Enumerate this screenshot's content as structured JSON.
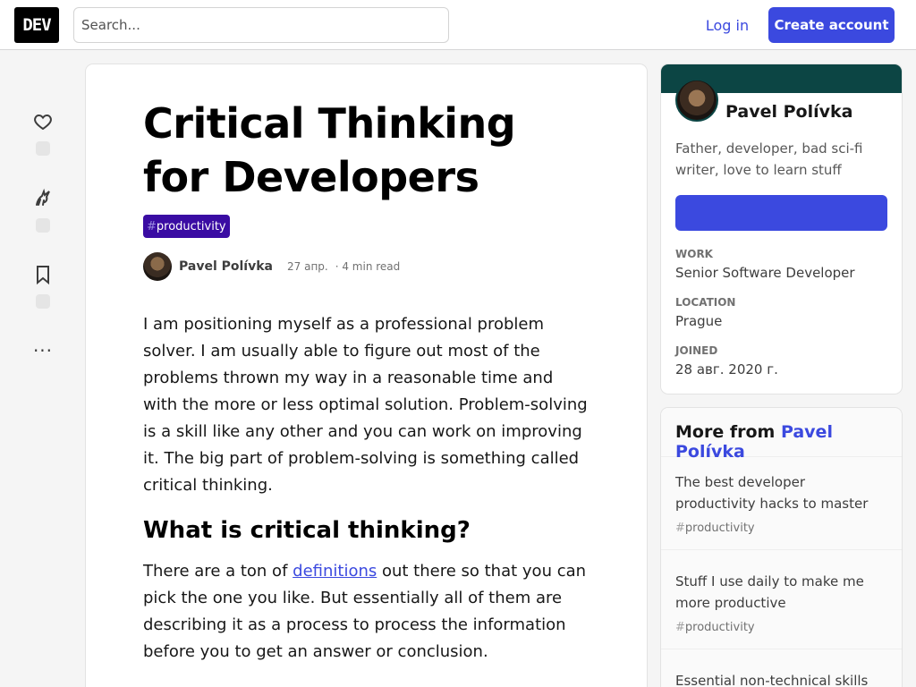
{
  "header": {
    "logo": "DEV",
    "search_placeholder": "Search...",
    "login_label": "Log in",
    "create_account_label": "Create account"
  },
  "actions": {
    "icons": [
      "heart-icon",
      "unicorn-icon",
      "bookmark-icon"
    ],
    "more_label": "···"
  },
  "article": {
    "title": "Critical Thinking for Developers",
    "tag_hash": "#",
    "tag": "productivity",
    "author": "Pavel Polívka",
    "date": "27 апр.",
    "read_time": "· 4 min read",
    "paragraph1": "I am positioning myself as a professional problem solver. I am usually able to figure out most of the problems thrown my way in a reasonable time and with the more or less optimal solution. Problem-solving is a skill like any other and you can work on improving it. The big part of problem-solving is something called critical thinking.",
    "heading2": "What is critical thinking?",
    "paragraph2_before": "There are a ton of ",
    "paragraph2_link": "definitions",
    "paragraph2_after": " out there so that you can pick the one you like. But essentially all of them are describing it as a process to process the information before you to get an answer or conclusion."
  },
  "profile": {
    "name": "Pavel Polívka",
    "bio": "Father, developer, bad sci-fi writer, love to learn stuff",
    "follow_label": "",
    "work_label": "WORK",
    "work_value": "Senior Software Developer",
    "location_label": "LOCATION",
    "location_value": "Prague",
    "joined_label": "JOINED",
    "joined_value": "28 авг. 2020 г.",
    "band_color": "#0c4544"
  },
  "more_from": {
    "prefix": "More from ",
    "author": "Pavel Polívka",
    "items": [
      {
        "title": "The best developer productivity hacks to master",
        "tag_hash": "#",
        "tag": "productivity"
      },
      {
        "title": "Stuff I use daily to make me more productive",
        "tag_hash": "#",
        "tag": "productivity"
      },
      {
        "title": "Essential non-technical skills",
        "tag_hash": "",
        "tag": ""
      }
    ]
  },
  "colors": {
    "accent": "#3b49df",
    "tag_bg": "#3a0ca3"
  }
}
